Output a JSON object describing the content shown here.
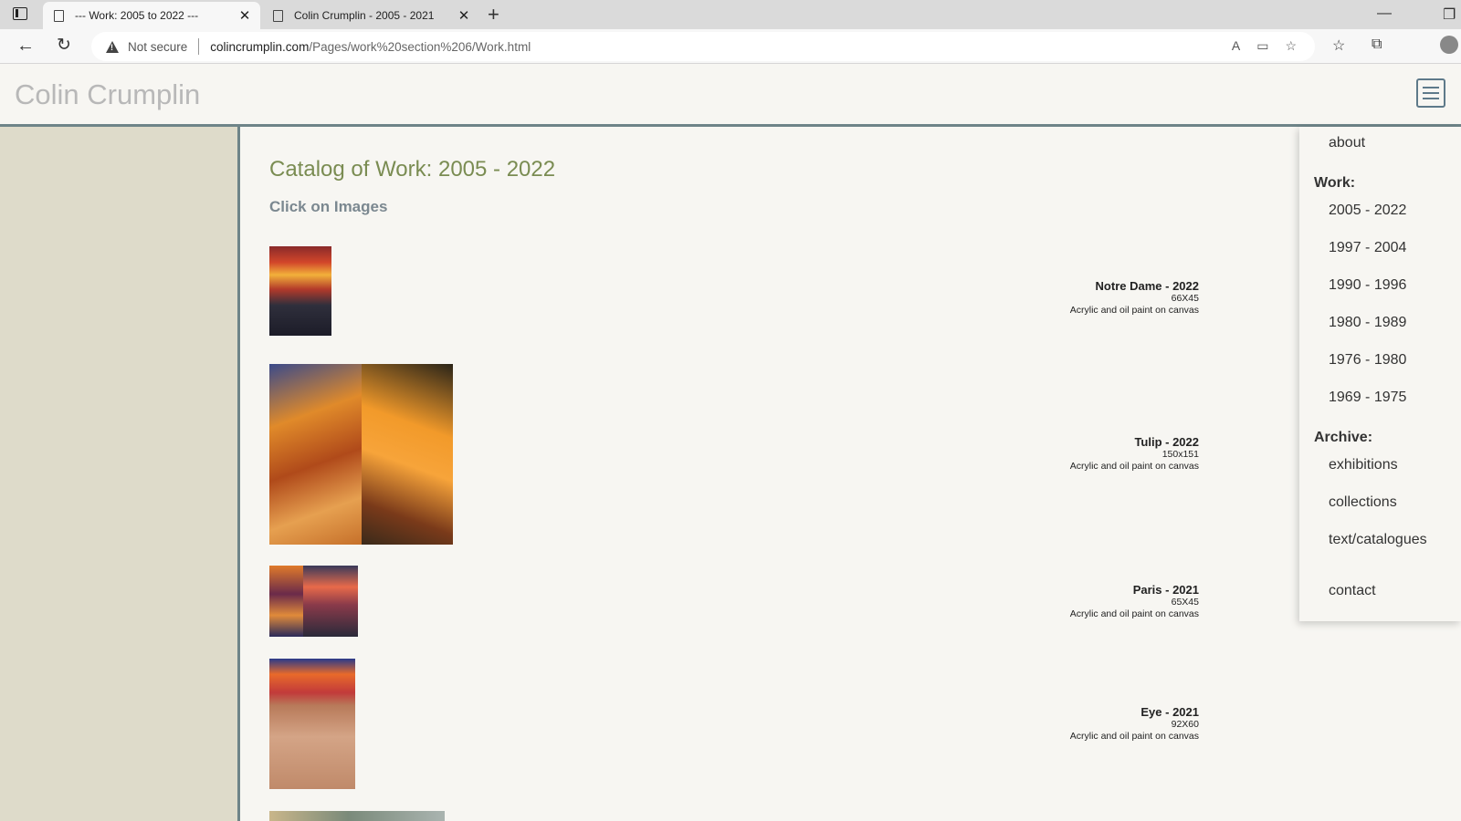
{
  "browser": {
    "tabs": [
      {
        "title": "--- Work: 2005 to 2022 ---",
        "active": true
      },
      {
        "title": "Colin Crumplin - 2005 - 2021",
        "active": false
      }
    ],
    "security_label": "Not secure",
    "url_host": "colincrumplin.com",
    "url_path": "/Pages/work%20section%206/Work.html"
  },
  "site": {
    "title": "Colin Crumplin",
    "page_title": "Catalog of Work: 2005 - 2022",
    "subtitle": "Click on Images"
  },
  "works": [
    {
      "name": "Notre Dame - 2022",
      "size": "66X45",
      "medium": "Acrylic and oil paint on canvas"
    },
    {
      "name": "Tulip - 2022",
      "size": "150x151",
      "medium": "Acrylic and oil paint on canvas"
    },
    {
      "name": "Paris - 2021",
      "size": "65X45",
      "medium": "Acrylic and oil paint on canvas"
    },
    {
      "name": "Eye - 2021",
      "size": "92X60",
      "medium": "Acrylic and oil paint on canvas"
    }
  ],
  "menu": {
    "about": "about",
    "work_heading": "Work:",
    "work_items": [
      "2005 - 2022",
      "1997 - 2004",
      "1990 - 1996",
      "1980 - 1989",
      "1976 - 1980",
      "1969 - 1975"
    ],
    "archive_heading": "Archive:",
    "archive_items": [
      "exhibitions",
      "collections",
      "text/catalogues"
    ],
    "contact": "contact"
  },
  "colors": {
    "accent_title": "#7a8c52",
    "rule": "#6e8488",
    "sidebar": "#dedbca",
    "background": "#f7f6f2"
  }
}
